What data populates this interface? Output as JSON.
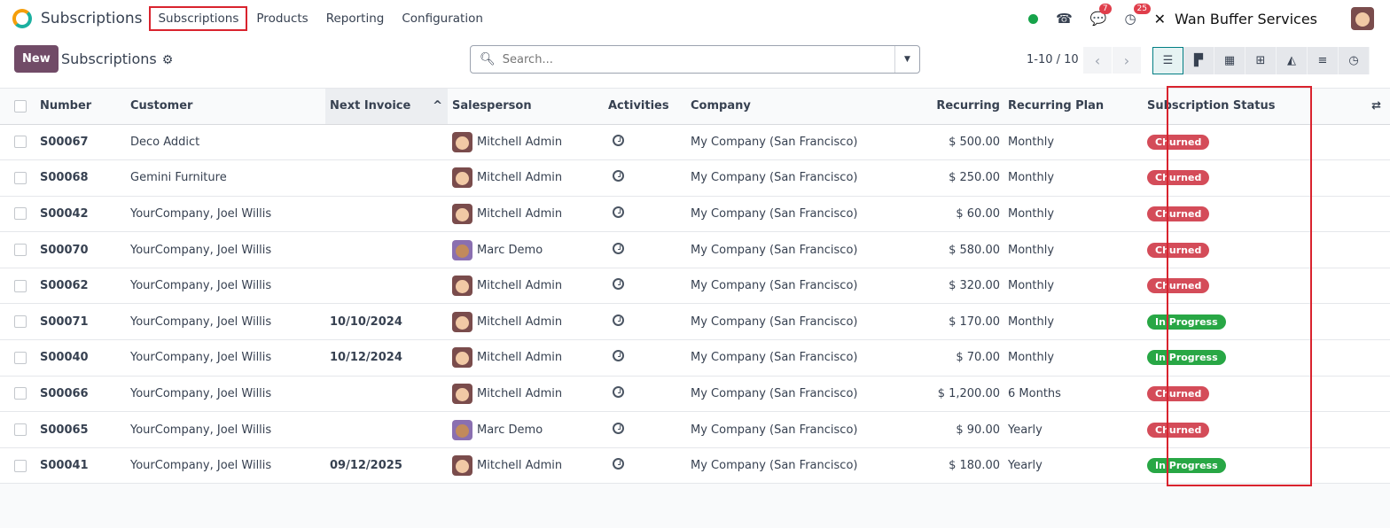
{
  "nav": {
    "app_name": "Subscriptions",
    "menu": [
      "Subscriptions",
      "Products",
      "Reporting",
      "Configuration"
    ],
    "messages_count": "7",
    "activities_count": "25",
    "company": "Wan Buffer Services"
  },
  "control": {
    "new_label": "New",
    "title": "Subscriptions",
    "search_placeholder": "Search...",
    "pager": "1-10 / 10"
  },
  "columns": {
    "number": "Number",
    "customer": "Customer",
    "next_invoice": "Next Invoice",
    "salesperson": "Salesperson",
    "activities": "Activities",
    "company": "Company",
    "recurring": "Recurring",
    "plan": "Recurring Plan",
    "status": "Subscription Status"
  },
  "status_colors": {
    "Churned": "#d44c59",
    "In Progress": "#28a745"
  },
  "rows": [
    {
      "number": "S00067",
      "customer": "Deco Addict",
      "next_invoice": "",
      "salesperson": "Mitchell Admin",
      "company": "My Company (San Francisco)",
      "recurring": "$ 500.00",
      "plan": "Monthly",
      "status": "Churned"
    },
    {
      "number": "S00068",
      "customer": "Gemini Furniture",
      "next_invoice": "",
      "salesperson": "Mitchell Admin",
      "company": "My Company (San Francisco)",
      "recurring": "$ 250.00",
      "plan": "Monthly",
      "status": "Churned"
    },
    {
      "number": "S00042",
      "customer": "YourCompany, Joel Willis",
      "next_invoice": "",
      "salesperson": "Mitchell Admin",
      "company": "My Company (San Francisco)",
      "recurring": "$ 60.00",
      "plan": "Monthly",
      "status": "Churned"
    },
    {
      "number": "S00070",
      "customer": "YourCompany, Joel Willis",
      "next_invoice": "",
      "salesperson": "Marc Demo",
      "company": "My Company (San Francisco)",
      "recurring": "$ 580.00",
      "plan": "Monthly",
      "status": "Churned"
    },
    {
      "number": "S00062",
      "customer": "YourCompany, Joel Willis",
      "next_invoice": "",
      "salesperson": "Mitchell Admin",
      "company": "My Company (San Francisco)",
      "recurring": "$ 320.00",
      "plan": "Monthly",
      "status": "Churned"
    },
    {
      "number": "S00071",
      "customer": "YourCompany, Joel Willis",
      "next_invoice": "10/10/2024",
      "salesperson": "Mitchell Admin",
      "company": "My Company (San Francisco)",
      "recurring": "$ 170.00",
      "plan": "Monthly",
      "status": "In Progress"
    },
    {
      "number": "S00040",
      "customer": "YourCompany, Joel Willis",
      "next_invoice": "10/12/2024",
      "salesperson": "Mitchell Admin",
      "company": "My Company (San Francisco)",
      "recurring": "$ 70.00",
      "plan": "Monthly",
      "status": "In Progress"
    },
    {
      "number": "S00066",
      "customer": "YourCompany, Joel Willis",
      "next_invoice": "",
      "salesperson": "Mitchell Admin",
      "company": "My Company (San Francisco)",
      "recurring": "$ 1,200.00",
      "plan": "6 Months",
      "status": "Churned"
    },
    {
      "number": "S00065",
      "customer": "YourCompany, Joel Willis",
      "next_invoice": "",
      "salesperson": "Marc Demo",
      "company": "My Company (San Francisco)",
      "recurring": "$ 90.00",
      "plan": "Yearly",
      "status": "Churned"
    },
    {
      "number": "S00041",
      "customer": "YourCompany, Joel Willis",
      "next_invoice": "09/12/2025",
      "salesperson": "Mitchell Admin",
      "company": "My Company (San Francisco)",
      "recurring": "$ 180.00",
      "plan": "Yearly",
      "status": "In Progress"
    }
  ]
}
